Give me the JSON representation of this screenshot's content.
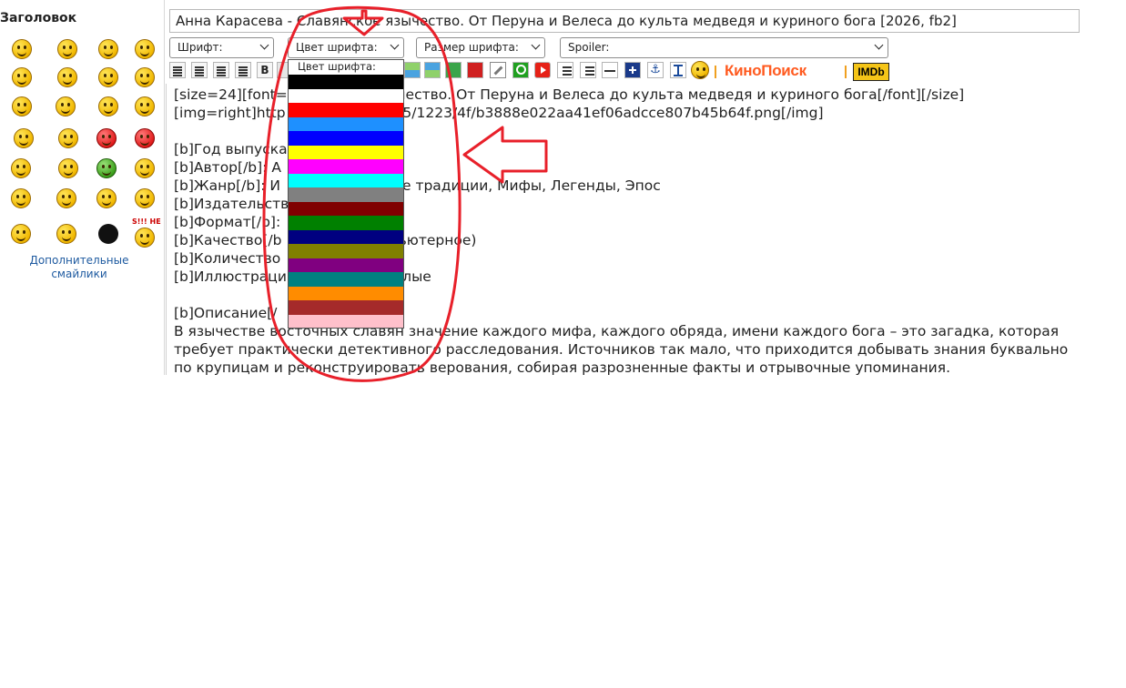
{
  "left_panel": {
    "title": "Заголовок",
    "more_smileys": "Дополнительные смайлики",
    "stamp_text": "S!!! HE"
  },
  "subject": {
    "value": "Анна Карасева - Славянское язычество. От Перуна и Велеса до культа медведя и куриного бога [2026, fb2]"
  },
  "selects": {
    "font": "Шрифт:",
    "color": "Цвет шрифта:",
    "size": "Размер шрифта:",
    "spoiler": "Spoiler:"
  },
  "toolbar": {
    "bold": "B",
    "kinopoisk": "КиноПоиск",
    "imdb": "IMDb",
    "icons": [
      "align-left-icon",
      "align-center-icon",
      "align-right-icon",
      "align-justify-icon",
      "bold-icon",
      "image-icon",
      "image-right-icon",
      "image-gallery-icon",
      "spoiler-icon",
      "link-icon",
      "search-icon",
      "youtube-icon",
      "list-bullet-icon",
      "list-number-icon",
      "horizontal-rule-icon",
      "plus-icon",
      "anchor-icon",
      "upload-icon",
      "smiley-icon"
    ]
  },
  "dropdown": {
    "header": "Цвет шрифта:",
    "colors": [
      "#000000",
      "#ffffff",
      "#ff0000",
      "#1e90ff",
      "#0000ff",
      "#ffff00",
      "#ff00ff",
      "#00ffff",
      "#808080",
      "#800000",
      "#008000",
      "#000080",
      "#808000",
      "#800080",
      "#008080",
      "#ff8c00",
      "#a52a2a",
      "#ffc0cb"
    ]
  },
  "body": {
    "lines": [
      "[size=24][font=      янское язычество. От Перуна и Велеса до культа медведя и куриного бога[/font][/size]",
      "[img=right]http       .org/big/2025/1223/4f/b3888e022aa41ef06adcce807b45b64f.png[/img]",
      "",
      "[b]Год выпуска",
      "[b]Автор[/b]: А",
      "[b]Жанр[/b]: И       , Культурные традиции, Мифы, Легенды, Эпос",
      "[b]Издательств",
      "[b]Формат[/b]:",
      "[b]Качество[/b       ально компьютерное)",
      "[b]Количество        65",
      "[b]Иллюстраци        и черно-белые",
      "",
      "[b]Описание[/",
      "В язычестве восточных славян значение каждого мифа, каждого обряда, имени каждого бога – это загадка, которая",
      "требует практически детективного расследования. Источников так мало, что приходится добывать знания буквально",
      "по крупицам и реконструировать верования, собирая разрозненные факты и отрывочные упоминания."
    ]
  },
  "annotation_color": "#e8202a"
}
